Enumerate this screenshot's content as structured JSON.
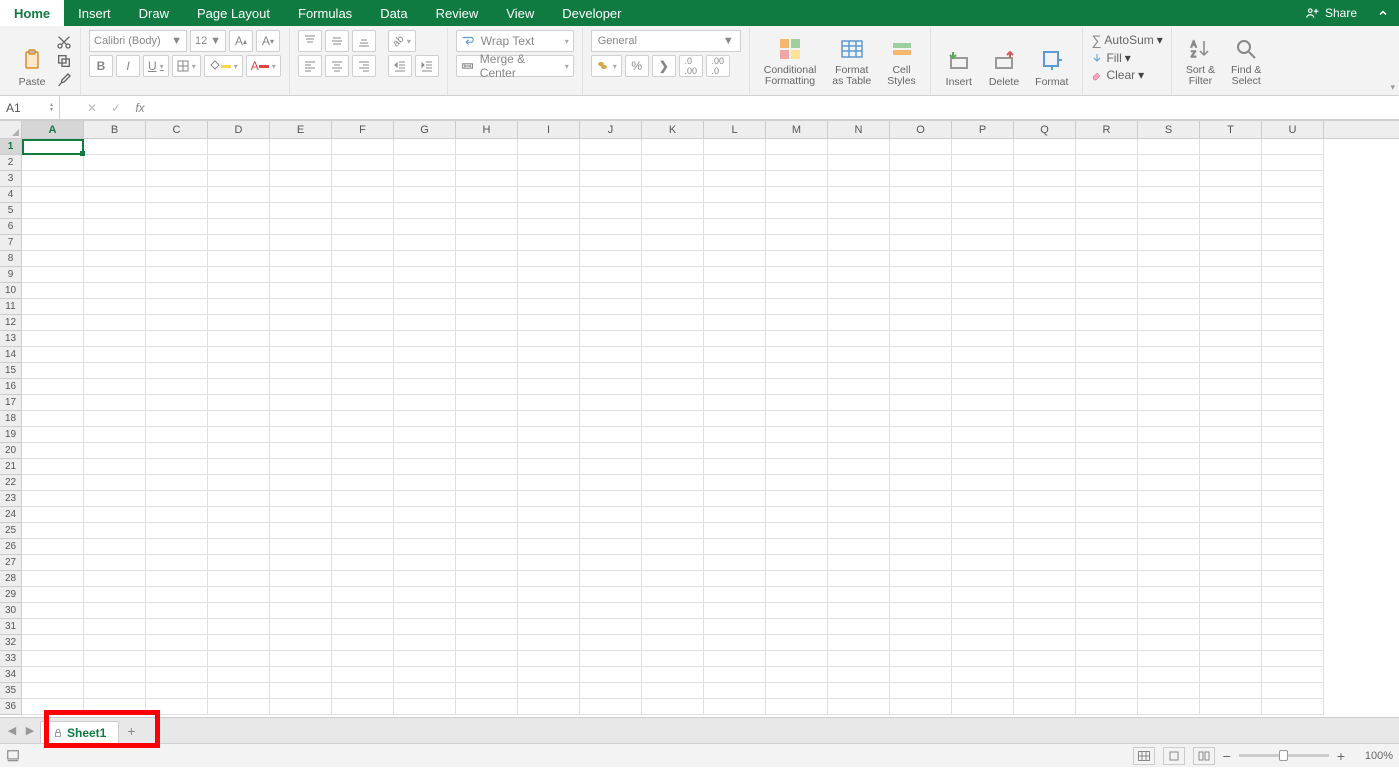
{
  "menubar": {
    "tabs": [
      "Home",
      "Insert",
      "Draw",
      "Page Layout",
      "Formulas",
      "Data",
      "Review",
      "View",
      "Developer"
    ],
    "active": 0,
    "share": "Share"
  },
  "ribbon": {
    "paste": "Paste",
    "font_name": "Calibri (Body)",
    "font_size": "12",
    "wrap": "Wrap Text",
    "merge": "Merge & Center",
    "number_format": "General",
    "cond_fmt": "Conditional\nFormatting",
    "as_table": "Format\nas Table",
    "styles": "Cell\nStyles",
    "insert": "Insert",
    "delete": "Delete",
    "format": "Format",
    "autosum": "AutoSum",
    "fill": "Fill",
    "clear": "Clear",
    "sort": "Sort &\nFilter",
    "find": "Find &\nSelect"
  },
  "formula_bar": {
    "name_box": "A1",
    "formula": ""
  },
  "grid": {
    "columns": [
      "A",
      "B",
      "C",
      "D",
      "E",
      "F",
      "G",
      "H",
      "I",
      "J",
      "K",
      "L",
      "M",
      "N",
      "O",
      "P",
      "Q",
      "R",
      "S",
      "T",
      "U"
    ],
    "rows": 36,
    "active_col": "A",
    "active_row": 1
  },
  "sheets": {
    "active": "Sheet1",
    "locked": true
  },
  "status": {
    "zoom": "100%"
  }
}
